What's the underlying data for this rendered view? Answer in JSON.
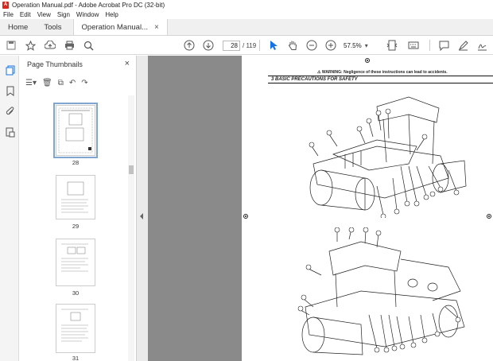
{
  "window": {
    "title": "Operation Manual.pdf - Adobe Acrobat Pro DC (32-bit)",
    "app_icon": "pdf-icon"
  },
  "menu": [
    "File",
    "Edit",
    "View",
    "Sign",
    "Window",
    "Help"
  ],
  "tabs": {
    "home": "Home",
    "tools": "Tools",
    "document": "Operation Manual...",
    "close": "×"
  },
  "toolbar": {
    "current_page": "28",
    "total_pages": "/ 119",
    "zoom": "57.5%",
    "zoom_arrow": "▾",
    "icons": [
      "save-icon",
      "star-icon",
      "cloud-upload-icon",
      "print-icon",
      "search-icon",
      "page-up-icon",
      "page-down-icon",
      "select-cursor-icon",
      "hand-icon",
      "zoom-out-icon",
      "zoom-in-icon",
      "fit-page-icon",
      "keyboard-icon",
      "comment-icon",
      "highlight-icon",
      "sign-icon",
      "share-icon"
    ]
  },
  "sidebar_panel": {
    "title": "Page Thumbnails",
    "close": "×",
    "thumbnails": [
      {
        "label": "28",
        "selected": true
      },
      {
        "label": "29",
        "selected": false
      },
      {
        "label": "30",
        "selected": false
      },
      {
        "label": "31",
        "selected": false
      }
    ]
  },
  "document_page": {
    "warning": "⚠ WARNING: Negligence of these instructions can lead to accidents.",
    "section_title": "3  BASIC PRECAUTIONS FOR SAFETY",
    "figure1_callouts": [
      "1",
      "2",
      "3",
      "4",
      "5",
      "6",
      "7",
      "8",
      "9",
      "10",
      "11",
      "12",
      "13",
      "14",
      "15"
    ],
    "figure2_callouts": [
      "16",
      "17",
      "18",
      "19",
      "20",
      "21",
      "22",
      "23",
      "24",
      "25",
      "26",
      "27",
      "28",
      "29",
      "30"
    ]
  },
  "colors": {
    "accent": "#1473e6",
    "canvas": "#8a8a8a",
    "pdf_red": "#d7291f"
  }
}
